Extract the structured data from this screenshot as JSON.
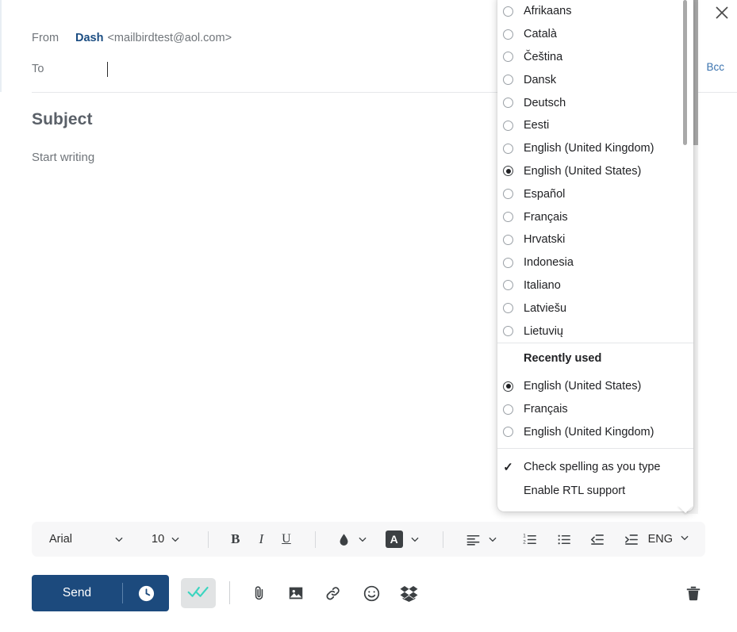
{
  "compose": {
    "from_label": "From",
    "from_name": "Dash",
    "from_address": "<mailbirdtest@aol.com>",
    "to_label": "To",
    "to_value": "",
    "bcc_label": "Bcc",
    "subject_placeholder": "Subject",
    "body_placeholder": "Start writing"
  },
  "format_toolbar": {
    "font_family": "Arial",
    "font_size": "10",
    "bold_label": "B",
    "italic_label": "I",
    "underline_label": "U",
    "highlight_label": "A",
    "language_label": "ENG"
  },
  "actions": {
    "send_label": "Send"
  },
  "language_menu": {
    "languages": [
      {
        "label": "Afrikaans",
        "selected": false
      },
      {
        "label": "Català",
        "selected": false
      },
      {
        "label": "Čeština",
        "selected": false
      },
      {
        "label": "Dansk",
        "selected": false
      },
      {
        "label": "Deutsch",
        "selected": false
      },
      {
        "label": "Eesti",
        "selected": false
      },
      {
        "label": "English (United Kingdom)",
        "selected": false
      },
      {
        "label": "English (United States)",
        "selected": true
      },
      {
        "label": "Español",
        "selected": false
      },
      {
        "label": "Français",
        "selected": false
      },
      {
        "label": "Hrvatski",
        "selected": false
      },
      {
        "label": "Indonesia",
        "selected": false
      },
      {
        "label": "Italiano",
        "selected": false
      },
      {
        "label": "Latviešu",
        "selected": false
      },
      {
        "label": "Lietuvių",
        "selected": false
      }
    ],
    "recently_used_header": "Recently used",
    "recently_used": [
      {
        "label": "English (United States)",
        "selected": true
      },
      {
        "label": "Français",
        "selected": false
      },
      {
        "label": "English (United Kingdom)",
        "selected": false
      }
    ],
    "options": [
      {
        "label": "Check spelling as you type",
        "checked": true
      },
      {
        "label": "Enable RTL support",
        "checked": false
      }
    ]
  },
  "colors": {
    "send_button": "#1c4a7d",
    "from_name": "#1b4d82",
    "link": "#3b73af",
    "read_receipt_check": "#3cd5c0",
    "highlight_chip": "#3c4043"
  }
}
